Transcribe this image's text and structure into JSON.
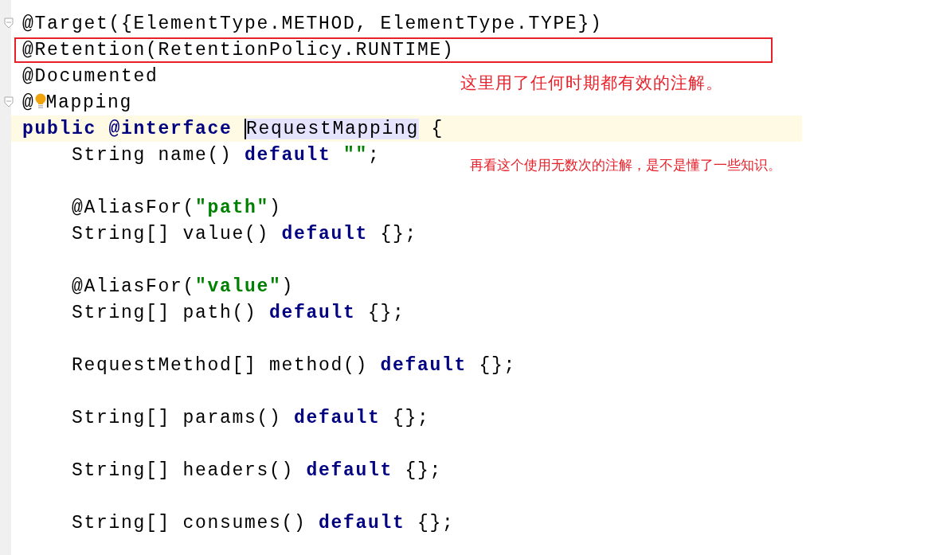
{
  "lines": [
    {
      "kind": "code",
      "tokens": [
        {
          "kind": "fold"
        },
        {
          "text": "@Target({ElementType.METHOD, ElementType.TYPE})",
          "kind": "plain"
        }
      ]
    },
    {
      "kind": "boxed",
      "tokens": [
        {
          "text": "@Retention(RetentionPolicy.RUNTIME)",
          "kind": "plain"
        }
      ]
    },
    {
      "kind": "code",
      "tokens": [
        {
          "text": "@Documented",
          "kind": "plain"
        }
      ]
    },
    {
      "kind": "code",
      "tokens": [
        {
          "kind": "fold"
        },
        {
          "text": "@",
          "kind": "plain"
        },
        {
          "kind": "bulb"
        },
        {
          "text": "Mapping",
          "kind": "plain"
        }
      ]
    },
    {
      "kind": "current",
      "tokens": [
        {
          "text": "public @interface ",
          "kind": "keyword"
        },
        {
          "kind": "caret"
        },
        {
          "text": "RequestMapping",
          "kind": "usage"
        },
        {
          "text": " {",
          "kind": "plain"
        }
      ]
    },
    {
      "kind": "code",
      "tokens": [
        {
          "text": "    String name() ",
          "kind": "plain"
        },
        {
          "text": "default",
          "kind": "keyword"
        },
        {
          "text": " \"\"",
          "kind": "string"
        },
        {
          "text": ";",
          "kind": "plain"
        }
      ]
    },
    {
      "kind": "blank"
    },
    {
      "kind": "code",
      "tokens": [
        {
          "text": "    @AliasFor(",
          "kind": "plain"
        },
        {
          "text": "\"path\"",
          "kind": "string"
        },
        {
          "text": ")",
          "kind": "plain"
        }
      ]
    },
    {
      "kind": "code",
      "tokens": [
        {
          "text": "    String[] value() ",
          "kind": "plain"
        },
        {
          "text": "default",
          "kind": "keyword"
        },
        {
          "text": " {};",
          "kind": "plain"
        }
      ]
    },
    {
      "kind": "blank"
    },
    {
      "kind": "code",
      "tokens": [
        {
          "text": "    @AliasFor(",
          "kind": "plain"
        },
        {
          "text": "\"value\"",
          "kind": "string"
        },
        {
          "text": ")",
          "kind": "plain"
        }
      ]
    },
    {
      "kind": "code",
      "tokens": [
        {
          "text": "    String[] path() ",
          "kind": "plain"
        },
        {
          "text": "default",
          "kind": "keyword"
        },
        {
          "text": " {};",
          "kind": "plain"
        }
      ]
    },
    {
      "kind": "blank"
    },
    {
      "kind": "code",
      "tokens": [
        {
          "text": "    RequestMethod[] method() ",
          "kind": "plain"
        },
        {
          "text": "default",
          "kind": "keyword"
        },
        {
          "text": " {};",
          "kind": "plain"
        }
      ]
    },
    {
      "kind": "blank"
    },
    {
      "kind": "code",
      "tokens": [
        {
          "text": "    String[] params() ",
          "kind": "plain"
        },
        {
          "text": "default",
          "kind": "keyword"
        },
        {
          "text": " {};",
          "kind": "plain"
        }
      ]
    },
    {
      "kind": "blank"
    },
    {
      "kind": "code",
      "tokens": [
        {
          "text": "    String[] headers() ",
          "kind": "plain"
        },
        {
          "text": "default",
          "kind": "keyword"
        },
        {
          "text": " {};",
          "kind": "plain"
        }
      ]
    },
    {
      "kind": "blank"
    },
    {
      "kind": "code",
      "tokens": [
        {
          "text": "    String[] consumes() ",
          "kind": "plain"
        },
        {
          "text": "default",
          "kind": "keyword"
        },
        {
          "text": " {};",
          "kind": "plain"
        }
      ]
    }
  ],
  "notes": [
    {
      "text": "这里用了任何时期都有效的注解。"
    },
    {
      "text": "再看这个使用无数次的注解，是不是懂了一些知识。"
    }
  ]
}
